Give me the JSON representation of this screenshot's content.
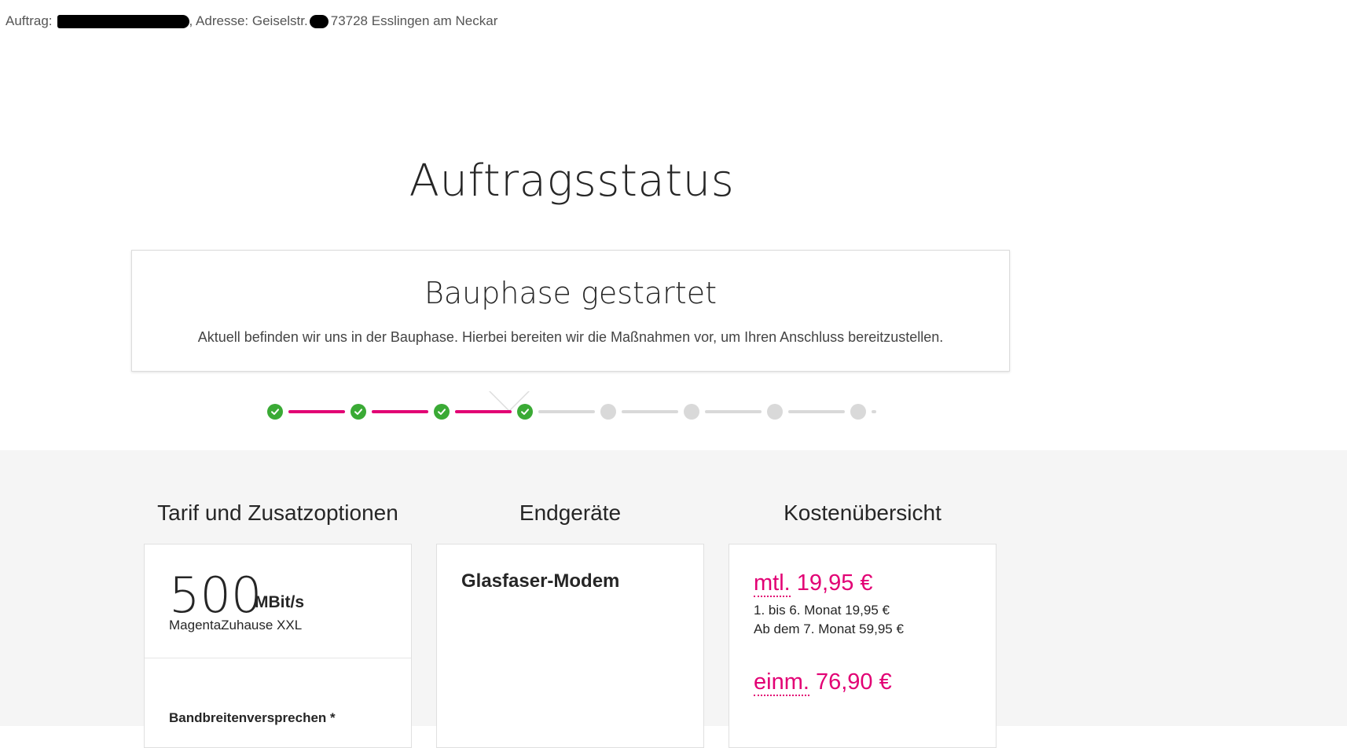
{
  "header": {
    "order_label": "Auftrag:",
    "address_prefix": ", Adresse: Geiselstr.",
    "address_rest": " 73728 Esslingen am Neckar"
  },
  "page_title": "Auftragsstatus",
  "status": {
    "title": "Bauphase gestartet",
    "description": "Aktuell befinden wir uns in der Bauphase. Hierbei bereiten wir die Maßnahmen vor, um Ihren Anschluss bereitzustellen.",
    "steps_total": 8,
    "steps_completed": 4
  },
  "colors": {
    "magenta": "#e20074",
    "done_green": "#3aaa35",
    "pending_grey": "#d9d9d9"
  },
  "sections": {
    "tariff": {
      "title": "Tarif und Zusatzoptionen",
      "speed_value": "500",
      "speed_unit": "MBit/s",
      "tariff_name": "MagentaZuhause XXL",
      "bandwidth_label": "Bandbreitenversprechen *"
    },
    "devices": {
      "title": "Endgeräte",
      "device_name": "Glasfaser-Modem"
    },
    "costs": {
      "title": "Kostenübersicht",
      "monthly_label": "mtl.",
      "monthly_amount": "19,95 €",
      "monthly_detail_1": "1. bis 6. Monat 19,95 €",
      "monthly_detail_2": "Ab dem 7. Monat 59,95 €",
      "onetime_label": "einm.",
      "onetime_amount": "76,90 €"
    }
  }
}
